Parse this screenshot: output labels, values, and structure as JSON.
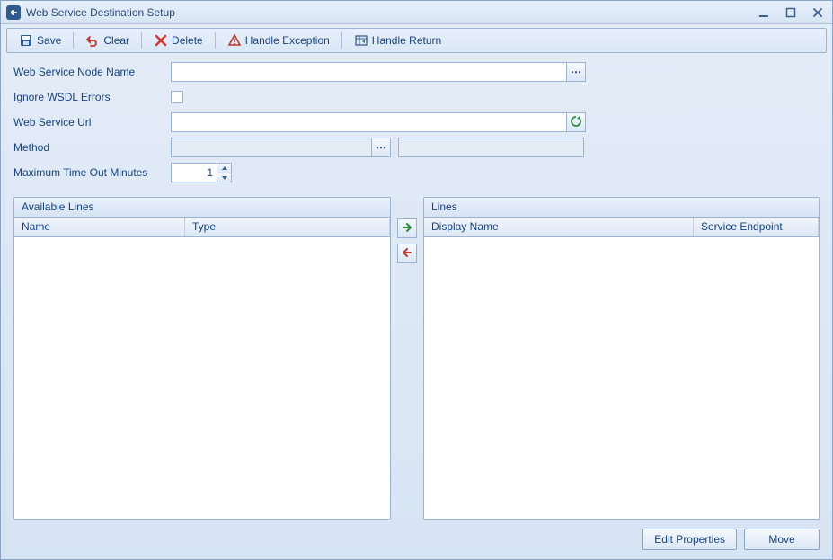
{
  "window": {
    "title": "Web Service Destination Setup"
  },
  "toolbar": {
    "save": "Save",
    "clear": "Clear",
    "delete": "Delete",
    "handle_exception": "Handle Exception",
    "handle_return": "Handle Return"
  },
  "form": {
    "node_name": {
      "label": "Web Service Node Name",
      "value": ""
    },
    "ignore_wsdl": {
      "label": "Ignore WSDL Errors",
      "checked": false
    },
    "url": {
      "label": "Web Service Url",
      "value": ""
    },
    "method": {
      "label": "Method",
      "value1": "",
      "value2": ""
    },
    "timeout": {
      "label": "Maximum Time Out Minutes",
      "value": "1"
    }
  },
  "panels": {
    "available": {
      "title": "Available Lines",
      "columns": [
        "Name",
        "Type"
      ],
      "rows": []
    },
    "lines": {
      "title": "Lines",
      "columns": [
        "Display Name",
        "Service Endpoint"
      ],
      "rows": []
    }
  },
  "footer": {
    "edit_properties": "Edit Properties",
    "move": "Move"
  },
  "icons": {
    "app": "link-icon",
    "save": "save-icon",
    "clear": "undo-icon",
    "delete": "delete-icon",
    "exception": "warning-icon",
    "return": "return-table-icon",
    "ellipsis": "ellipsis-icon",
    "refresh": "refresh-icon",
    "arrow_right": "arrow-right-icon",
    "arrow_left": "arrow-left-icon",
    "minimize": "minimize-icon",
    "maximize": "maximize-icon",
    "close": "close-icon"
  }
}
